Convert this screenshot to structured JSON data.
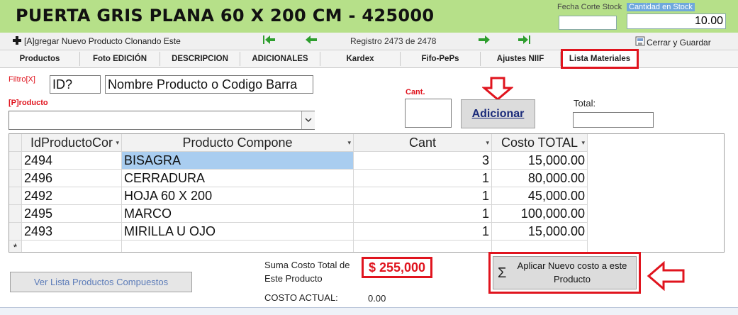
{
  "header": {
    "title": "PUERTA GRIS PLANA 60 X 200 CM - 425000",
    "fecha_corte_label": "Fecha Corte Stock",
    "cantidad_stock_label": "Cantidad en Stock",
    "fecha_corte_value": "",
    "cantidad_stock_value": "10.00"
  },
  "toolbar": {
    "clone_label": "[A]gregar Nuevo Producto Clonando Este",
    "record_label": "Registro 2473 de 2478",
    "close_save_label": "Cerrar y Guardar"
  },
  "tabs": [
    {
      "label": "Productos"
    },
    {
      "label": "Foto EDICIÓN"
    },
    {
      "label": "DESCRIPCION"
    },
    {
      "label": "ADICIONALES"
    },
    {
      "label": "Kardex"
    },
    {
      "label": "Fifo-PePs"
    },
    {
      "label": "Ajustes NIIF"
    },
    {
      "label": "Lista Materiales",
      "active": true
    }
  ],
  "filter": {
    "label": "Filtro[X]",
    "id_value": "ID?",
    "name_value": "Nombre Producto o Codigo Barra"
  },
  "product": {
    "label": "[P]roducto",
    "value": ""
  },
  "cant": {
    "label": "Cant.",
    "value": ""
  },
  "add_button": {
    "label": "Adicionar"
  },
  "total": {
    "label": "Total:",
    "value": ""
  },
  "grid": {
    "columns": [
      "IdProductoCor",
      "Producto Compone",
      "Cant",
      "Costo TOTAL"
    ],
    "rows": [
      {
        "id": "2494",
        "product": "BISAGRA",
        "cant": "3",
        "cost": "15,000.00",
        "selected": true
      },
      {
        "id": "2496",
        "product": "CERRADURA",
        "cant": "1",
        "cost": "80,000.00"
      },
      {
        "id": "2492",
        "product": "HOJA 60 X 200",
        "cant": "1",
        "cost": "45,000.00"
      },
      {
        "id": "2495",
        "product": "MARCO",
        "cant": "1",
        "cost": "100,000.00"
      },
      {
        "id": "2493",
        "product": "MIRILLA U OJO",
        "cant": "1",
        "cost": "15,000.00"
      }
    ],
    "new_row_marker": "*"
  },
  "footer": {
    "view_list_label": "Ver Lista Productos Compuestos",
    "sum_label_line1": "Suma Costo Total de",
    "sum_label_line2": "Este Producto",
    "sum_value": "$ 255,000",
    "current_cost_label": "COSTO ACTUAL:",
    "current_cost_value": "0.00",
    "apply_label_line1": "Aplicar Nuevo costo a este",
    "apply_label_line2": "Producto"
  },
  "colors": {
    "header_bg": "#b6e089",
    "annotation_red": "#e0141e",
    "selection_blue": "#a9cdf0",
    "nav_green": "#2e9e2e"
  }
}
